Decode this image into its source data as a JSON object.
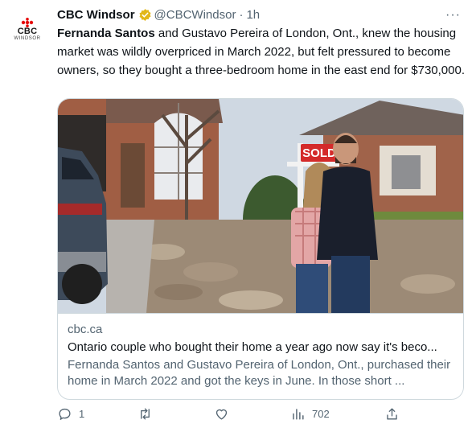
{
  "tweet": {
    "author_name": "CBC Windsor",
    "author_handle": "@CBCWindsor",
    "separator": "·",
    "time": "1h",
    "more_label": "···",
    "avatar": {
      "logo_text": "CBC",
      "logo_sub": "WINDSOR",
      "colors": [
        "#e60505",
        "#ffffff"
      ]
    },
    "text_bold": "Fernanda Santos",
    "text_rest": " and Gustavo Pereira of London, Ont., knew the housing market was wildly overpriced in March 2022, but felt pressured to become owners, so they bought a three-bedroom home in the east end for $730,000."
  },
  "card": {
    "image_sign_text": "SOLD",
    "domain": "cbc.ca",
    "title": "Ontario couple who bought their home a year ago now say it's beco...",
    "description": "Fernanda Santos and Gustavo Pereira of London, Ont., purchased their home in March 2022 and got the keys in June. In those short ..."
  },
  "actions": {
    "reply_count": "1",
    "retweet_count": "",
    "like_count": "",
    "views_count": "702"
  },
  "colors": {
    "verified": "#e2b719",
    "muted": "#536471",
    "border": "#cfd9de",
    "sold_sign": "#d42a2a"
  }
}
